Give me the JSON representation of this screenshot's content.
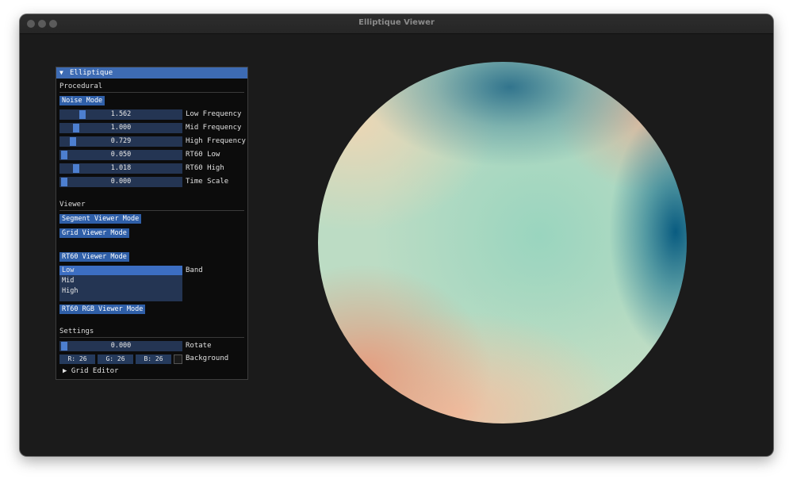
{
  "window": {
    "title": "Elliptique Viewer"
  },
  "panel": {
    "title": "Elliptique",
    "collapse_icon": "triangle-down-icon",
    "procedural": {
      "header": "Procedural",
      "noise_mode_label": "Noise Mode",
      "sliders": [
        {
          "value": "1.562",
          "label": "Low Frequency"
        },
        {
          "value": "1.000",
          "label": "Mid Frequency"
        },
        {
          "value": "0.729",
          "label": "High Frequency"
        },
        {
          "value": "0.050",
          "label": "RT60 Low"
        },
        {
          "value": "1.018",
          "label": "RT60 High"
        },
        {
          "value": "0.000",
          "label": "Time Scale"
        }
      ]
    },
    "viewer": {
      "header": "Viewer",
      "segment_mode_label": "Segment Viewer Mode",
      "grid_mode_label": "Grid Viewer Mode",
      "rt60_mode_label": "RT60 Viewer Mode",
      "band_label": "Band",
      "band_options": [
        "Low",
        "Mid",
        "High"
      ],
      "band_selected": "Low",
      "rt60_rgb_mode_label": "RT60 RGB Viewer Mode"
    },
    "settings": {
      "header": "Settings",
      "rotate_value": "0.000",
      "rotate_label": "Rotate",
      "background": {
        "r": "R: 26",
        "g": "G: 26",
        "b": "B: 26",
        "label": "Background",
        "color": "#1a1a1a"
      },
      "grid_editor_label": "Grid Editor",
      "grid_editor_icon": "triangle-right-icon"
    }
  },
  "colors": {
    "accent": "#3d6bb3",
    "window_bg": "#1b1b1b",
    "panel_bg": "#0c0c0c"
  }
}
